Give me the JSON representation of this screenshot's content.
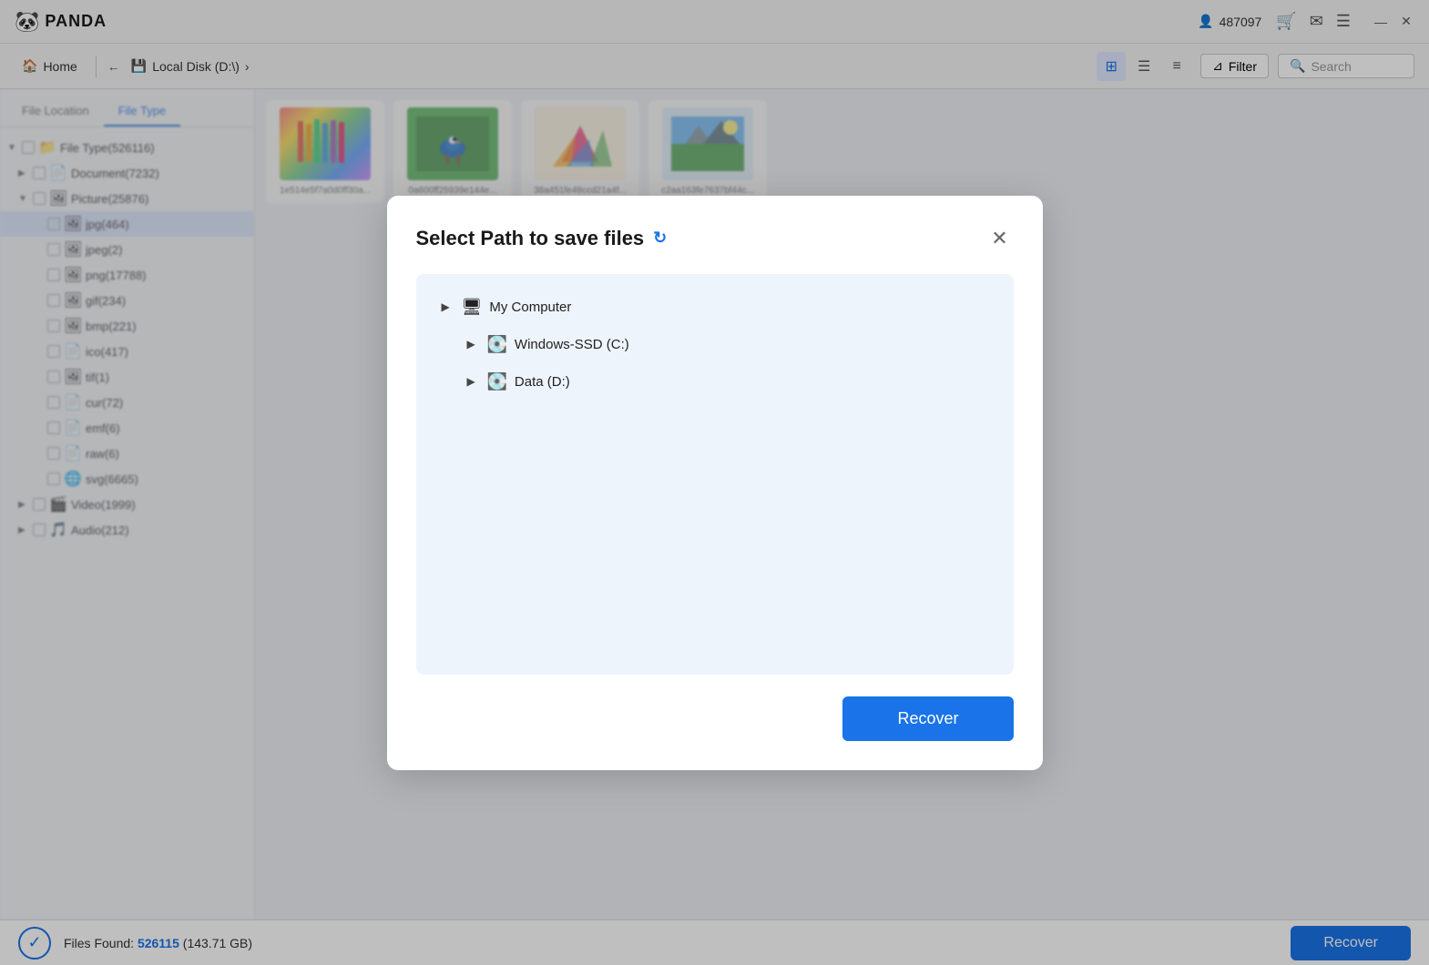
{
  "titlebar": {
    "logo": "🐼",
    "app_name": "PANDA",
    "user_icon": "👤",
    "user_id": "487097",
    "cart_icon": "🛒",
    "mail_icon": "✉",
    "menu_icon": "☰",
    "min_icon": "—",
    "close_icon": "✕"
  },
  "toolbar": {
    "home_label": "Home",
    "home_icon": "🏠",
    "back_icon": "←",
    "breadcrumb_icon": "💾",
    "breadcrumb_label": "Local Disk (D:\\)",
    "breadcrumb_arrow": "›",
    "grid_icon": "⊞",
    "list_icon": "☰",
    "detail_icon": "≡",
    "filter_icon": "⊿",
    "filter_label": "Filter",
    "search_icon": "🔍",
    "search_placeholder": "Search"
  },
  "sidebar": {
    "tab_location": "File Location",
    "tab_type": "File Type",
    "active_tab": "File Type",
    "tree": [
      {
        "label": "File Type(526116)",
        "icon": "📁",
        "level": 0,
        "expanded": true
      },
      {
        "label": "Document(7232)",
        "icon": "📄",
        "level": 1,
        "expanded": false
      },
      {
        "label": "Picture(25876)",
        "icon": "🖼",
        "level": 1,
        "expanded": true
      },
      {
        "label": "jpg(464)",
        "icon": "🖼",
        "level": 2,
        "selected": true
      },
      {
        "label": "jpeg(2)",
        "icon": "🖼",
        "level": 2
      },
      {
        "label": "png(17788)",
        "icon": "🖼",
        "level": 2
      },
      {
        "label": "gif(234)",
        "icon": "🖼",
        "level": 2
      },
      {
        "label": "bmp(221)",
        "icon": "🖼",
        "level": 2
      },
      {
        "label": "ico(417)",
        "icon": "📄",
        "level": 2
      },
      {
        "label": "tif(1)",
        "icon": "🖼",
        "level": 2
      },
      {
        "label": "cur(72)",
        "icon": "📄",
        "level": 2
      },
      {
        "label": "emf(6)",
        "icon": "📄",
        "level": 2
      },
      {
        "label": "raw(6)",
        "icon": "📄",
        "level": 2
      },
      {
        "label": "svg(6665)",
        "icon": "🌐",
        "level": 2
      },
      {
        "label": "Video(1999)",
        "icon": "🎬",
        "level": 1,
        "expanded": false
      },
      {
        "label": "Audio(212)",
        "icon": "🎵",
        "level": 1,
        "expanded": false
      }
    ]
  },
  "content": {
    "thumbnails": [
      {
        "label": "1e514e5f7a0d0ff30a...",
        "color": "#f5f5f5"
      },
      {
        "label": "0a600ff25939e144e...",
        "color": "#e8f5e9"
      },
      {
        "label": "38a451fe48ccd21a4f...",
        "color": "#fff3e0"
      },
      {
        "label": "c2aa163fe7637bf44c...",
        "color": "#e3f2fd"
      }
    ]
  },
  "statusbar": {
    "check_icon": "✓",
    "files_found_label": "Files Found:",
    "files_count": "526115",
    "files_size": "(143.71 GB)",
    "recover_label": "Recover"
  },
  "dialog": {
    "title": "Select Path to save files",
    "refresh_icon": "↻",
    "close_icon": "✕",
    "tree": [
      {
        "label": "My Computer",
        "icon": "🖥",
        "arrow": "▶",
        "level": 0,
        "children": [
          {
            "label": "Windows-SSD (C:)",
            "icon": "💽",
            "arrow": "▶",
            "level": 1
          },
          {
            "label": "Data (D:)",
            "icon": "💽",
            "arrow": "▶",
            "level": 1
          }
        ]
      }
    ],
    "recover_label": "Recover"
  }
}
